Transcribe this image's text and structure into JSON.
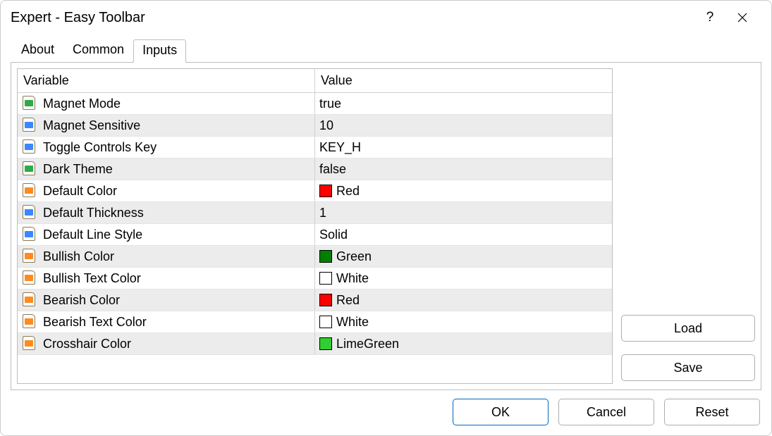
{
  "window": {
    "title": "Expert - Easy Toolbar"
  },
  "tabs": [
    {
      "label": "About",
      "active": false
    },
    {
      "label": "Common",
      "active": false
    },
    {
      "label": "Inputs",
      "active": true
    }
  ],
  "columns": {
    "variable": "Variable",
    "value": "Value"
  },
  "rows": [
    {
      "icon": "bool",
      "name": "Magnet Mode",
      "value": "true"
    },
    {
      "icon": "num",
      "name": "Magnet Sensitive",
      "value": "10"
    },
    {
      "icon": "num",
      "name": "Toggle Controls Key",
      "value": "KEY_H"
    },
    {
      "icon": "bool",
      "name": "Dark Theme",
      "value": "false"
    },
    {
      "icon": "color",
      "name": "Default Color",
      "value": "Red",
      "swatch": "#ff0000"
    },
    {
      "icon": "num",
      "name": "Default Thickness",
      "value": "1"
    },
    {
      "icon": "num",
      "name": "Default Line Style",
      "value": "Solid"
    },
    {
      "icon": "color",
      "name": "Bullish Color",
      "value": "Green",
      "swatch": "#008000"
    },
    {
      "icon": "color",
      "name": "Bullish Text Color",
      "value": "White",
      "swatch": "#ffffff"
    },
    {
      "icon": "color",
      "name": "Bearish Color",
      "value": "Red",
      "swatch": "#ff0000"
    },
    {
      "icon": "color",
      "name": "Bearish Text Color",
      "value": "White",
      "swatch": "#ffffff"
    },
    {
      "icon": "color",
      "name": "Crosshair Color",
      "value": "LimeGreen",
      "swatch": "#32cd32"
    }
  ],
  "buttons": {
    "load": "Load",
    "save": "Save",
    "ok": "OK",
    "cancel": "Cancel",
    "reset": "Reset"
  }
}
